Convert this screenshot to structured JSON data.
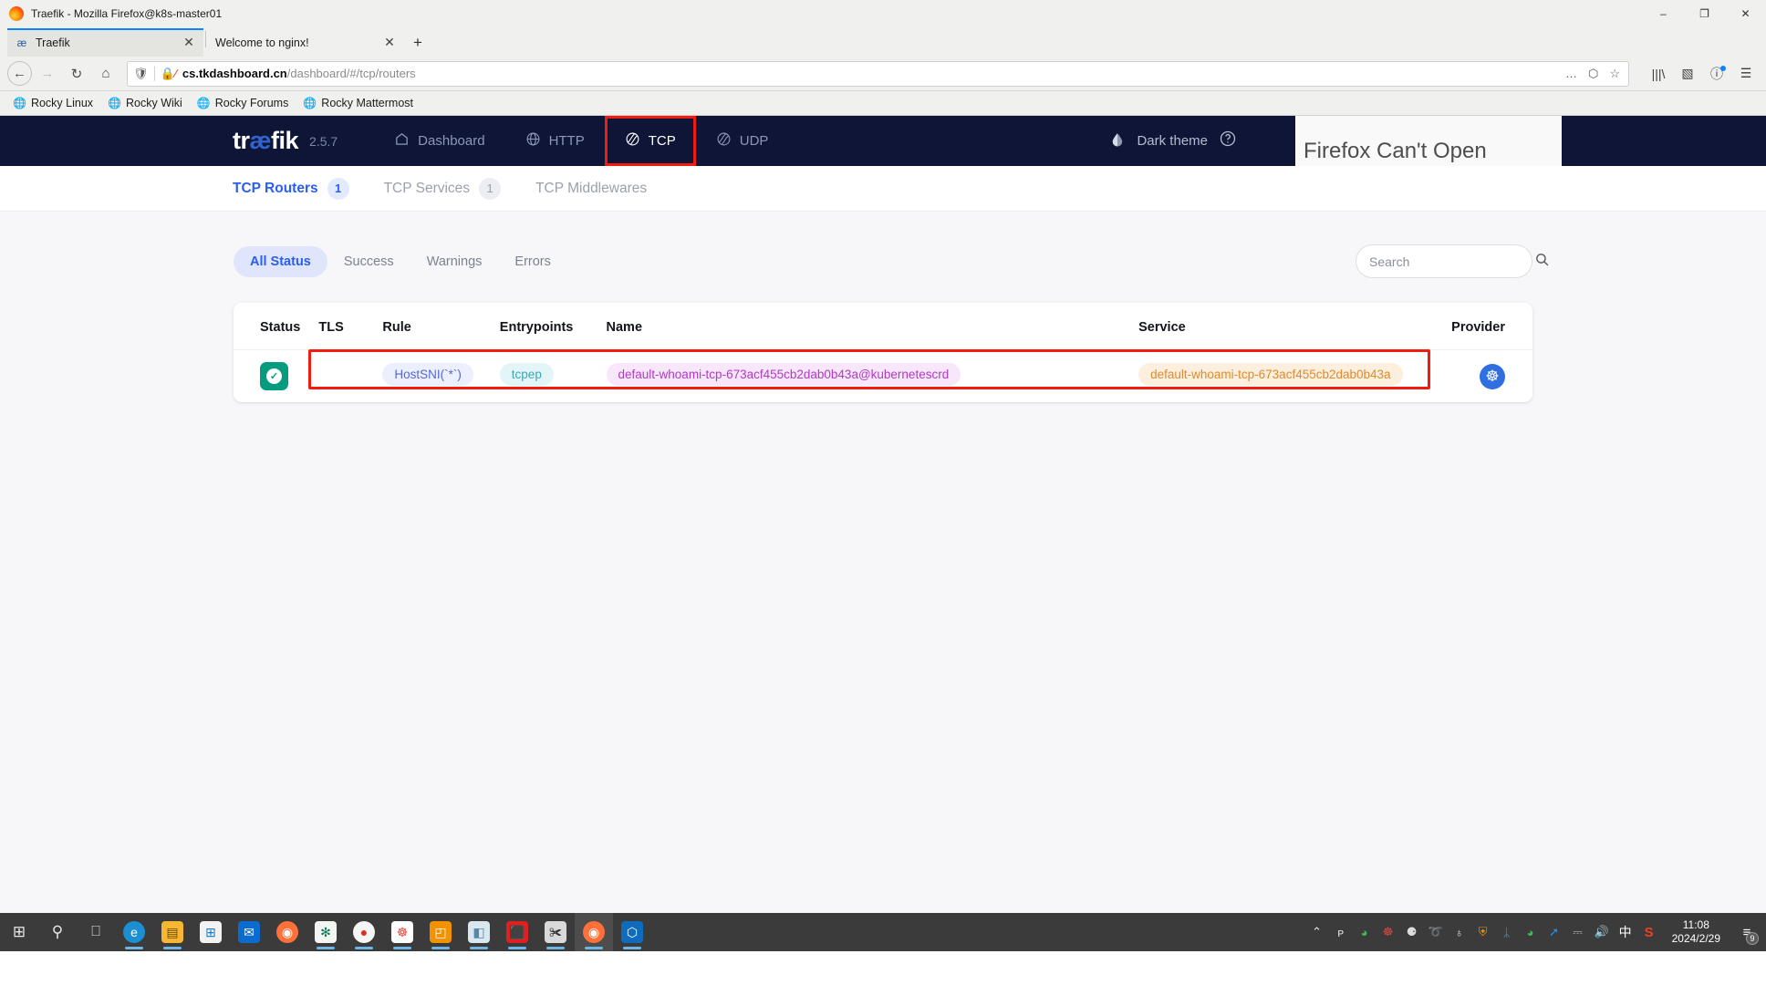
{
  "window": {
    "title": "Traefik - Mozilla Firefox@k8s-master01",
    "minimize_label": "–",
    "maximize_label": "❐",
    "close_label": "✕"
  },
  "browser": {
    "tabs": [
      {
        "label": "Traefik",
        "favicon": "æ",
        "close_label": "✕",
        "active": true
      },
      {
        "label": "Welcome to nginx!",
        "favicon": "",
        "close_label": "✕",
        "active": false
      }
    ],
    "new_tab_label": "+",
    "nav": {
      "back_label": "←",
      "forward_label": "→",
      "reload_label": "↻",
      "home_label": "⌂"
    },
    "url": {
      "domain": "cs.tkdashboard.cn",
      "path": "/dashboard/#/tcp/routers",
      "shield_icon": "shield-icon",
      "cert_icon": "broken-lock-icon",
      "more_label": "…",
      "pocket_label": "⬡",
      "bookmark_label": "☆"
    },
    "toolbar_right": [
      {
        "name": "library-icon",
        "glyph": "|||\\"
      },
      {
        "name": "sidebar-icon",
        "glyph": "▧"
      },
      {
        "name": "account-icon",
        "glyph": "ⓘ"
      },
      {
        "name": "app-menu-icon",
        "glyph": "☰"
      }
    ],
    "bookmarks": [
      {
        "label": "Rocky Linux"
      },
      {
        "label": "Rocky Wiki"
      },
      {
        "label": "Rocky Forums"
      },
      {
        "label": "Rocky Mattermost"
      }
    ]
  },
  "firefox_panel": {
    "title": "Firefox Can't Open"
  },
  "traefik": {
    "logo": {
      "pre": "tr",
      "ae": "æ",
      "post": "fik"
    },
    "version": "2.5.7",
    "nav": [
      {
        "label": "Dashboard",
        "icon": "home-icon",
        "active": false,
        "highlight": false
      },
      {
        "label": "HTTP",
        "icon": "globe-icon",
        "active": false,
        "highlight": false
      },
      {
        "label": "TCP",
        "icon": "tcp-icon",
        "active": true,
        "highlight": true
      },
      {
        "label": "UDP",
        "icon": "udp-icon",
        "active": false,
        "highlight": false
      }
    ],
    "theme_label": "Dark theme",
    "theme_icon": "droplet-icon",
    "help_icon": "help-icon",
    "subtabs": [
      {
        "label": "TCP Routers",
        "count": "1",
        "active": true
      },
      {
        "label": "TCP Services",
        "count": "1",
        "active": false
      },
      {
        "label": "TCP Middlewares",
        "count": "",
        "active": false
      }
    ],
    "status_filters": [
      {
        "label": "All Status",
        "active": true
      },
      {
        "label": "Success",
        "active": false
      },
      {
        "label": "Warnings",
        "active": false
      },
      {
        "label": "Errors",
        "active": false
      }
    ],
    "search": {
      "value": "",
      "placeholder": "Search",
      "icon": "search-icon"
    },
    "table": {
      "columns": [
        "Status",
        "TLS",
        "Rule",
        "Entrypoints",
        "Name",
        "Service",
        "Provider"
      ],
      "rows": [
        {
          "status": "success",
          "status_icon": "check-icon",
          "tls": "",
          "rule": "HostSNI(`*`)",
          "entrypoints": "tcpep",
          "name": "default-whoami-tcp-673acf455cb2dab0b43a@kubernetescrd",
          "service": "default-whoami-tcp-673acf455cb2dab0b43a",
          "provider": "kubernetes-icon"
        }
      ]
    },
    "colors": {
      "header_bg": "#0f1536",
      "accent": "#2b5ef3",
      "highlight_box": "#f21b0f",
      "status_success": "#059b7f"
    }
  },
  "taskbar": {
    "left_items": [
      {
        "name": "start-button",
        "glyph": "⊞",
        "bg": "transparent",
        "fg": "#ffffff",
        "running": false
      },
      {
        "name": "search-button",
        "glyph": "⚲",
        "bg": "transparent",
        "fg": "#ffffff",
        "running": false
      },
      {
        "name": "task-view-button",
        "glyph": "⎕",
        "bg": "transparent",
        "fg": "#ffffff",
        "running": false
      },
      {
        "name": "edge-icon",
        "glyph": "e",
        "bg": "#1b8fd1",
        "fg": "#ffffff",
        "running": true
      },
      {
        "name": "file-explorer-icon",
        "glyph": "▤",
        "bg": "#f7b733",
        "fg": "#6b4a00",
        "running": true
      },
      {
        "name": "microsoft-store-icon",
        "glyph": "⊞",
        "bg": "#f2f2f2",
        "fg": "#1277c4",
        "running": false
      },
      {
        "name": "mail-icon",
        "glyph": "✉",
        "bg": "#0a6cce",
        "fg": "#ffffff",
        "running": false
      },
      {
        "name": "firefox-icon",
        "glyph": "◉",
        "bg": "#ff7139",
        "fg": "#ffffff",
        "running": false
      },
      {
        "name": "openai-icon",
        "glyph": "✻",
        "bg": "#f2f5f2",
        "fg": "#0c7a5b",
        "running": true
      },
      {
        "name": "chrome-icon",
        "glyph": "●",
        "bg": "#f5f5f5",
        "fg": "#d93025",
        "running": true
      },
      {
        "name": "app-icon-1",
        "glyph": "☸",
        "bg": "#ffffff",
        "fg": "#e8453c",
        "running": true
      },
      {
        "name": "app-icon-2",
        "glyph": "◰",
        "bg": "#f39200",
        "fg": "#ffffff",
        "running": true
      },
      {
        "name": "app-icon-3",
        "glyph": "◧",
        "bg": "#d8e7f0",
        "fg": "#5b86a3",
        "running": true
      },
      {
        "name": "app-icon-4",
        "glyph": "⬛",
        "bg": "#e02020",
        "fg": "#ffffff",
        "running": true
      },
      {
        "name": "screenshot-tool-icon",
        "glyph": "✀",
        "bg": "#d9d9d9",
        "fg": "#333333",
        "running": true
      },
      {
        "name": "firefox-active-icon",
        "glyph": "◉",
        "bg": "#ff7139",
        "fg": "#ffffff",
        "running": true
      },
      {
        "name": "vscode-icon",
        "glyph": "⬡",
        "bg": "#0f6cbd",
        "fg": "#ffffff",
        "running": true
      }
    ],
    "tray_expand": "⌃",
    "tray_items": [
      {
        "name": "microphone-icon",
        "glyph": "ᴘ",
        "fg": "#dddddd"
      },
      {
        "name": "wechat-icon",
        "glyph": "◕",
        "fg": "#3fbd4d"
      },
      {
        "name": "app-tray-1-icon",
        "glyph": "☸",
        "fg": "#e8453c"
      },
      {
        "name": "qq-icon",
        "glyph": "⚈",
        "fg": "#dddddd"
      },
      {
        "name": "app-tray-2-icon",
        "glyph": "➰",
        "fg": "#4f9ee8"
      },
      {
        "name": "network-globe-icon",
        "glyph": "♁",
        "fg": "#dddddd"
      },
      {
        "name": "security-shield-icon",
        "glyph": "⛨",
        "fg": "#f39200"
      },
      {
        "name": "bluetooth-icon",
        "glyph": "ᛦ",
        "fg": "#3ba2f0"
      },
      {
        "name": "wechat-2-icon",
        "glyph": "◕",
        "fg": "#3fbd4d"
      },
      {
        "name": "app-tray-3-icon",
        "glyph": "➚",
        "fg": "#2f8fe0"
      },
      {
        "name": "network-icon",
        "glyph": "⎓",
        "fg": "#dddddd"
      },
      {
        "name": "volume-icon",
        "glyph": "🔊",
        "fg": "#dddddd"
      },
      {
        "name": "ime-icon",
        "glyph": "中",
        "fg": "#ffffff"
      },
      {
        "name": "sogou-icon",
        "glyph": "S",
        "fg": "#ef4123"
      }
    ],
    "clock": {
      "time": "11:08",
      "date": "2024/2/29"
    },
    "action_center": {
      "glyph": "≡",
      "count": "9"
    }
  }
}
